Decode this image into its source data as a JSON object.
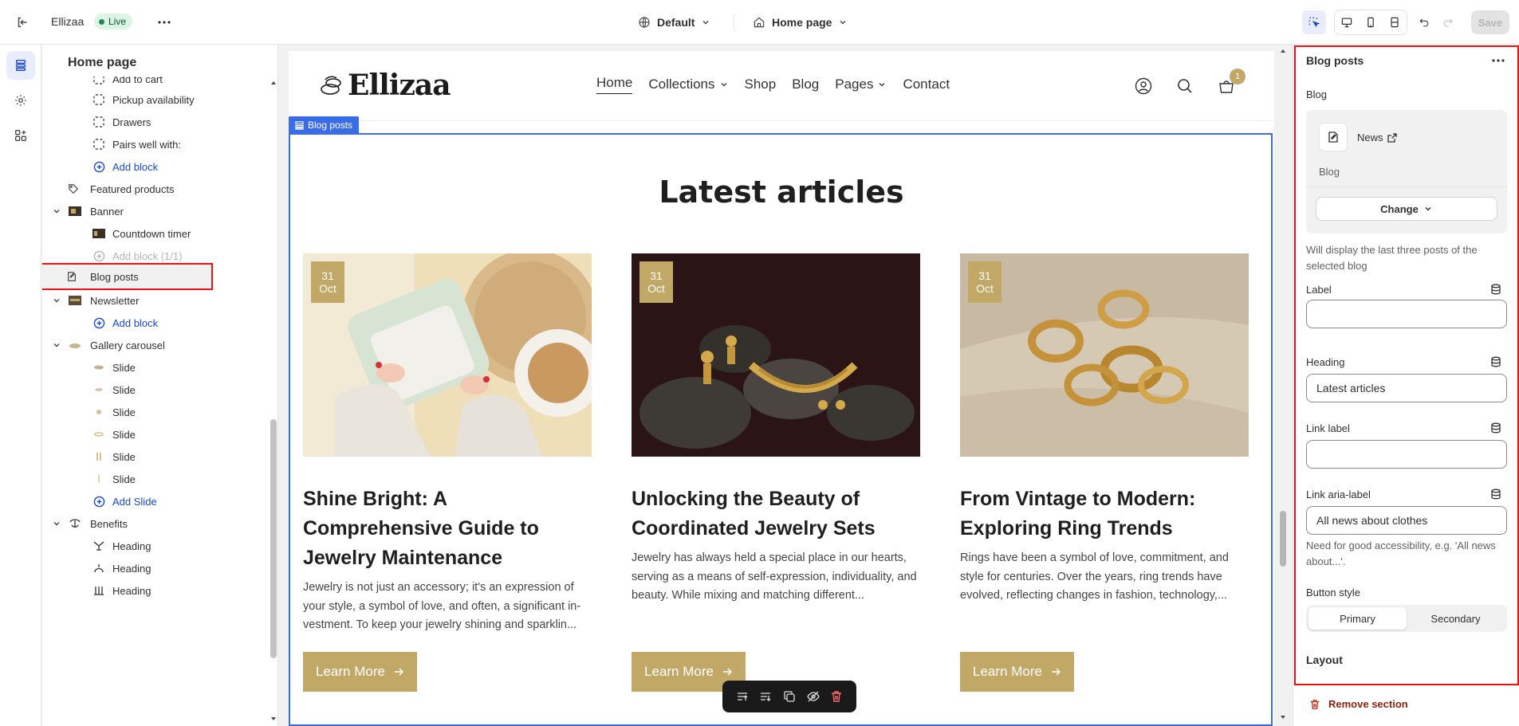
{
  "topbar": {
    "store_name": "Ellizaa",
    "status_badge": "Live",
    "theme": "Default",
    "page": "Home page",
    "save_label": "Save"
  },
  "sidebar": {
    "title": "Home page",
    "items": [
      {
        "label": "Add to cart"
      },
      {
        "label": "Pickup availability"
      },
      {
        "label": "Drawers"
      },
      {
        "label": "Pairs well with:"
      },
      {
        "label": "Add block"
      },
      {
        "label": "Featured products"
      },
      {
        "label": "Banner"
      },
      {
        "label": "Countdown timer"
      },
      {
        "label": "Add block (1/1)"
      },
      {
        "label": "Blog posts"
      },
      {
        "label": "Newsletter"
      },
      {
        "label": "Add block"
      },
      {
        "label": "Gallery carousel"
      },
      {
        "label": "Slide"
      },
      {
        "label": "Slide"
      },
      {
        "label": "Slide"
      },
      {
        "label": "Slide"
      },
      {
        "label": "Slide"
      },
      {
        "label": "Slide"
      },
      {
        "label": "Add Slide"
      },
      {
        "label": "Benefits"
      },
      {
        "label": "Heading"
      },
      {
        "label": "Heading"
      },
      {
        "label": "Heading"
      }
    ]
  },
  "preview": {
    "logo": "Ellizaa",
    "nav": [
      "Home",
      "Collections",
      "Shop",
      "Blog",
      "Pages",
      "Contact"
    ],
    "cart_count": "1",
    "selected_tag": "Blog posts",
    "heading": "Latest articles",
    "articles": [
      {
        "day": "31",
        "month": "Oct",
        "title": "Shine Bright: A Comprehensive Guide to Jewelry Maintenance",
        "excerpt": "Jewelry is not just an accessory; it's an expression of your style, a symbol of love, and often, a significant in-vestment. To keep your jewelry shining and sparklin...",
        "button": "Learn More"
      },
      {
        "day": "31",
        "month": "Oct",
        "title": "Unlocking the Beauty of Coordinated Jewelry Sets",
        "excerpt": "Jewelry has always held a special place in our hearts, serving as a means of self-expression, individuality, and beauty. While mixing and matching different...",
        "button": "Learn More"
      },
      {
        "day": "31",
        "month": "Oct",
        "title": "From Vintage to Modern: Exploring Ring Trends",
        "excerpt": "Rings have been a symbol of love, commitment, and style for centuries. Over the years, ring trends have evolved, reflecting changes in fashion, technology,...",
        "button": "Learn More"
      }
    ]
  },
  "panel": {
    "title": "Blog posts",
    "blog_label": "Blog",
    "blog_name": "News",
    "blog_sub": "Blog",
    "change_label": "Change",
    "blog_help": "Will display the last three posts of the selected blog",
    "label_label": "Label",
    "label_value": "",
    "heading_label": "Heading",
    "heading_value": "Latest articles",
    "link_label_label": "Link label",
    "link_label_value": "",
    "aria_label_label": "Link aria-label",
    "aria_label_value": "All news about clothes",
    "aria_help": "Need for good accessibility, e.g. 'All news about...'.",
    "button_style_label": "Button style",
    "button_style_options": [
      "Primary",
      "Secondary"
    ],
    "button_style_selected": "Primary",
    "layout_label": "Layout",
    "remove_label": "Remove section"
  },
  "colors": {
    "accent_gold": "#c2a867",
    "selection_blue": "#3b6ce8",
    "highlight_red": "#e11111",
    "link_blue": "#1a47cd"
  }
}
